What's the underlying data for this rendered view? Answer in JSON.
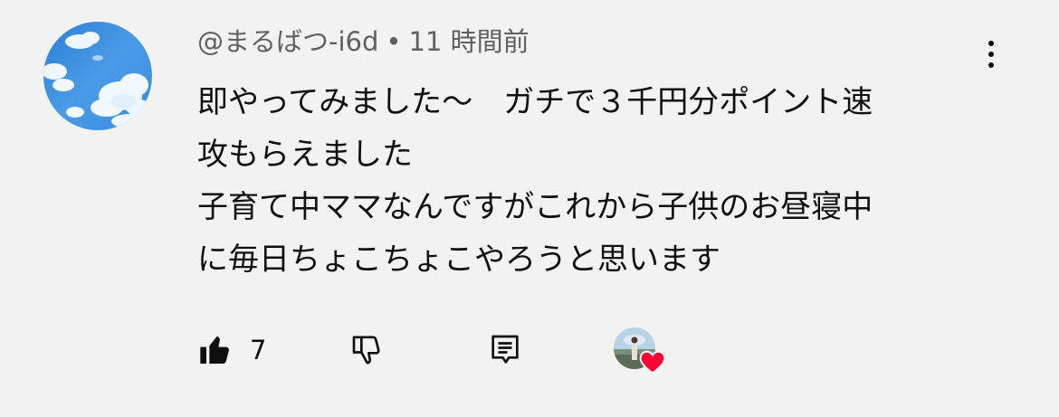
{
  "comment": {
    "author": "@まるばつ-i6d",
    "separator": "•",
    "time": "11 時間前",
    "lines": [
      "即やってみました〜　ガチで３千円分ポイント速",
      "攻もらえました",
      "子育て中ママなんですがこれから子供のお昼寝中",
      "に毎日ちょこちょこやろうと思います"
    ],
    "like_count": "7"
  },
  "icons": {
    "menu": "more-vert-icon",
    "like": "thumbs-up-filled-icon",
    "dislike": "thumbs-down-outline-icon",
    "reply": "comment-reply-icon",
    "heart": "creator-heart-icon"
  },
  "colors": {
    "background": "#f2f2f2",
    "text": "#0f0f0f",
    "meta": "#606060",
    "heart": "#ff0033"
  }
}
